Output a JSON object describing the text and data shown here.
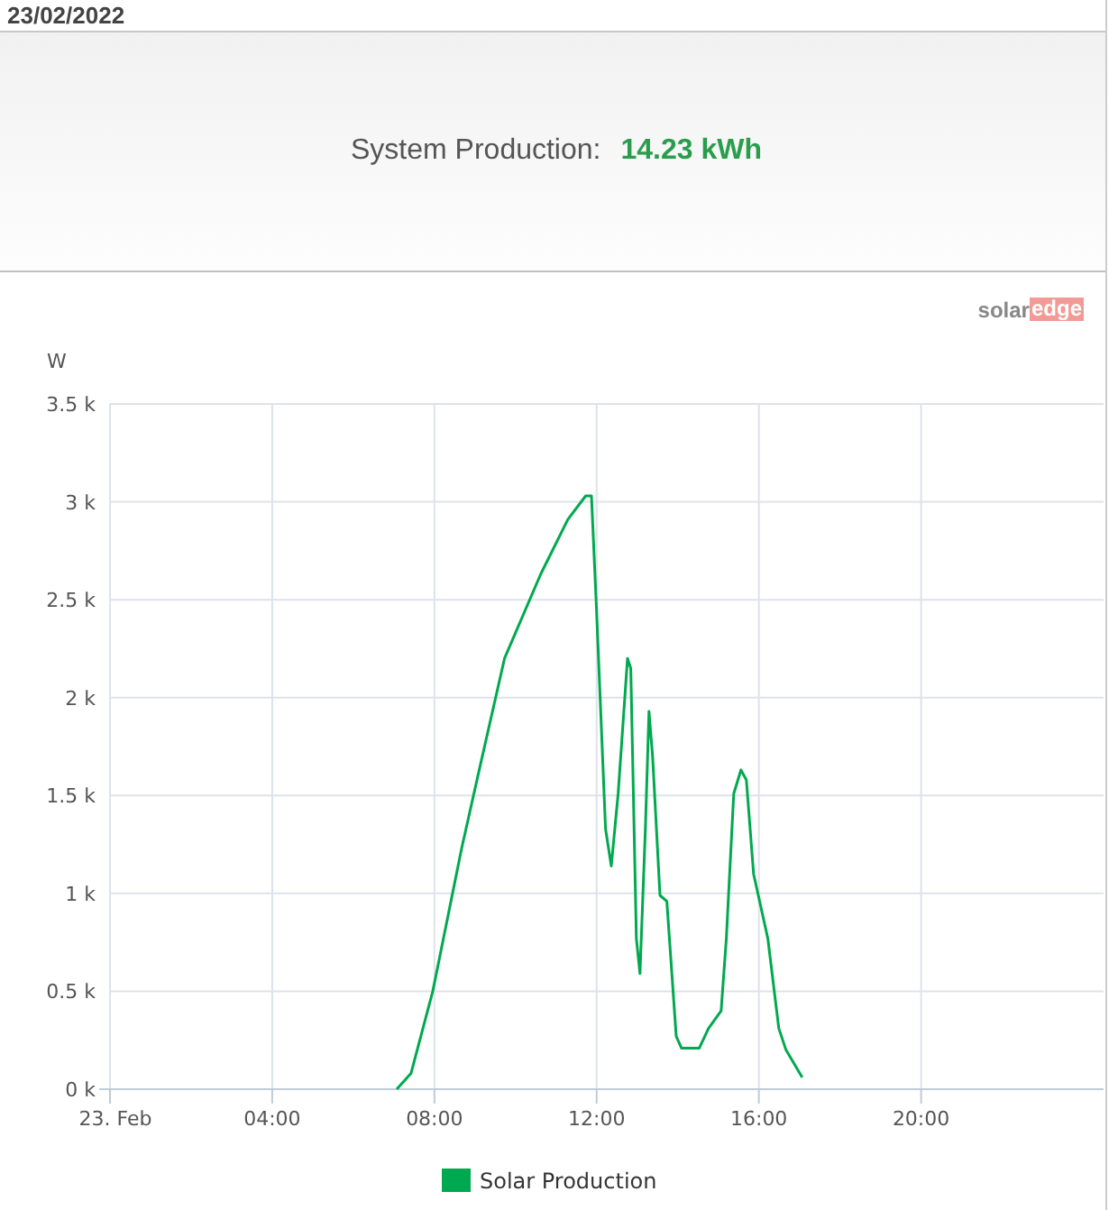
{
  "date": "23/02/2022",
  "summary": {
    "label": "System Production:",
    "value": "14.23 kWh"
  },
  "logo": {
    "part_1": "solar",
    "part_2": "edge"
  },
  "chart": {
    "chart_data": {
      "type": "line",
      "ylabel": "W",
      "grid": true,
      "xlim": [
        0,
        24.5
      ],
      "ylim": [
        0,
        3500
      ],
      "xticks": [
        {
          "value": 0,
          "label": "23. Feb"
        },
        {
          "value": 4,
          "label": "04:00"
        },
        {
          "value": 8,
          "label": "08:00"
        },
        {
          "value": 12,
          "label": "12:00"
        },
        {
          "value": 16,
          "label": "16:00"
        },
        {
          "value": 20,
          "label": "20:00"
        }
      ],
      "yticks": [
        {
          "value": 0,
          "label": "0 k"
        },
        {
          "value": 500,
          "label": "0.5 k"
        },
        {
          "value": 1000,
          "label": "1 k"
        },
        {
          "value": 1500,
          "label": "1.5 k"
        },
        {
          "value": 2000,
          "label": "2 k"
        },
        {
          "value": 2500,
          "label": "2.5 k"
        },
        {
          "value": 3000,
          "label": "3 k"
        },
        {
          "value": 3500,
          "label": "3.5 k"
        }
      ],
      "x": [
        7.07,
        7.42,
        7.96,
        8.67,
        9.07,
        9.73,
        10.62,
        11.29,
        11.73,
        11.87,
        12.0,
        12.22,
        12.36,
        12.53,
        12.76,
        12.84,
        12.98,
        13.07,
        13.2,
        13.29,
        13.38,
        13.56,
        13.73,
        13.96,
        14.09,
        14.53,
        14.76,
        15.07,
        15.2,
        15.38,
        15.56,
        15.69,
        15.87,
        16.22,
        16.49,
        16.67,
        17.07
      ],
      "series": [
        {
          "name": "Solar Production",
          "color": "#00a94f",
          "values": [
            0,
            80,
            500,
            1230,
            1600,
            2200,
            2630,
            2910,
            3030,
            3030,
            2430,
            1330,
            1140,
            1510,
            2200,
            2150,
            770,
            590,
            1330,
            1930,
            1700,
            990,
            960,
            270,
            210,
            210,
            310,
            400,
            770,
            1510,
            1630,
            1580,
            1100,
            770,
            310,
            200,
            60
          ]
        }
      ]
    }
  }
}
